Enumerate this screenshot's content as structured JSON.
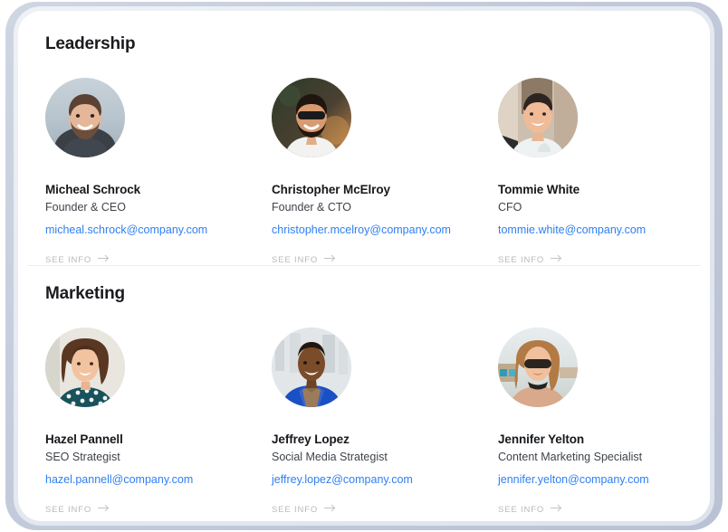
{
  "window": {
    "frame_color": "#c3cbdb",
    "bezel_color": "#e9edf4",
    "screen_bg": "#ffffff"
  },
  "theme": {
    "accent_link": "#2f7ff2",
    "heading_color": "#1b1b1f",
    "role_color": "#3f434a",
    "muted_color": "#b6bac0",
    "divider_color": "#eceef1"
  },
  "sections": [
    {
      "id": "leadership",
      "title": "Leadership",
      "people": [
        {
          "name": "Micheal Schrock",
          "role": "Founder & CEO",
          "email": "micheal.schrock@company.com",
          "cta": "SEE INFO",
          "avatar_alt": "bearded-man-beach-portrait"
        },
        {
          "name": "Christopher McElroy",
          "role": "Founder & CTO",
          "email": "christopher.mcelroy@company.com",
          "cta": "SEE INFO",
          "avatar_alt": "man-sunglasses-white-shirt-portrait"
        },
        {
          "name": "Tommie White",
          "role": "CFO",
          "email": "tommie.white@company.com",
          "cta": "SEE INFO",
          "avatar_alt": "smiling-man-white-tee-portrait"
        }
      ]
    },
    {
      "id": "marketing",
      "title": "Marketing",
      "people": [
        {
          "name": "Hazel Pannell",
          "role": "SEO Strategist",
          "email": "hazel.pannell@company.com",
          "cta": "SEE INFO",
          "avatar_alt": "curly-hair-woman-patterned-top-portrait"
        },
        {
          "name": "Jeffrey Lopez",
          "role": "Social Media Strategist",
          "email": "jeffrey.lopez@company.com",
          "cta": "SEE INFO",
          "avatar_alt": "man-blue-blazer-portrait"
        },
        {
          "name": "Jennifer Yelton",
          "role": "Content Marketing Specialist",
          "email": "jennifer.yelton@company.com",
          "cta": "SEE INFO",
          "avatar_alt": "woman-sunglasses-beach-portrait"
        }
      ]
    }
  ],
  "icons": {
    "arrow": "arrow-right-icon"
  }
}
